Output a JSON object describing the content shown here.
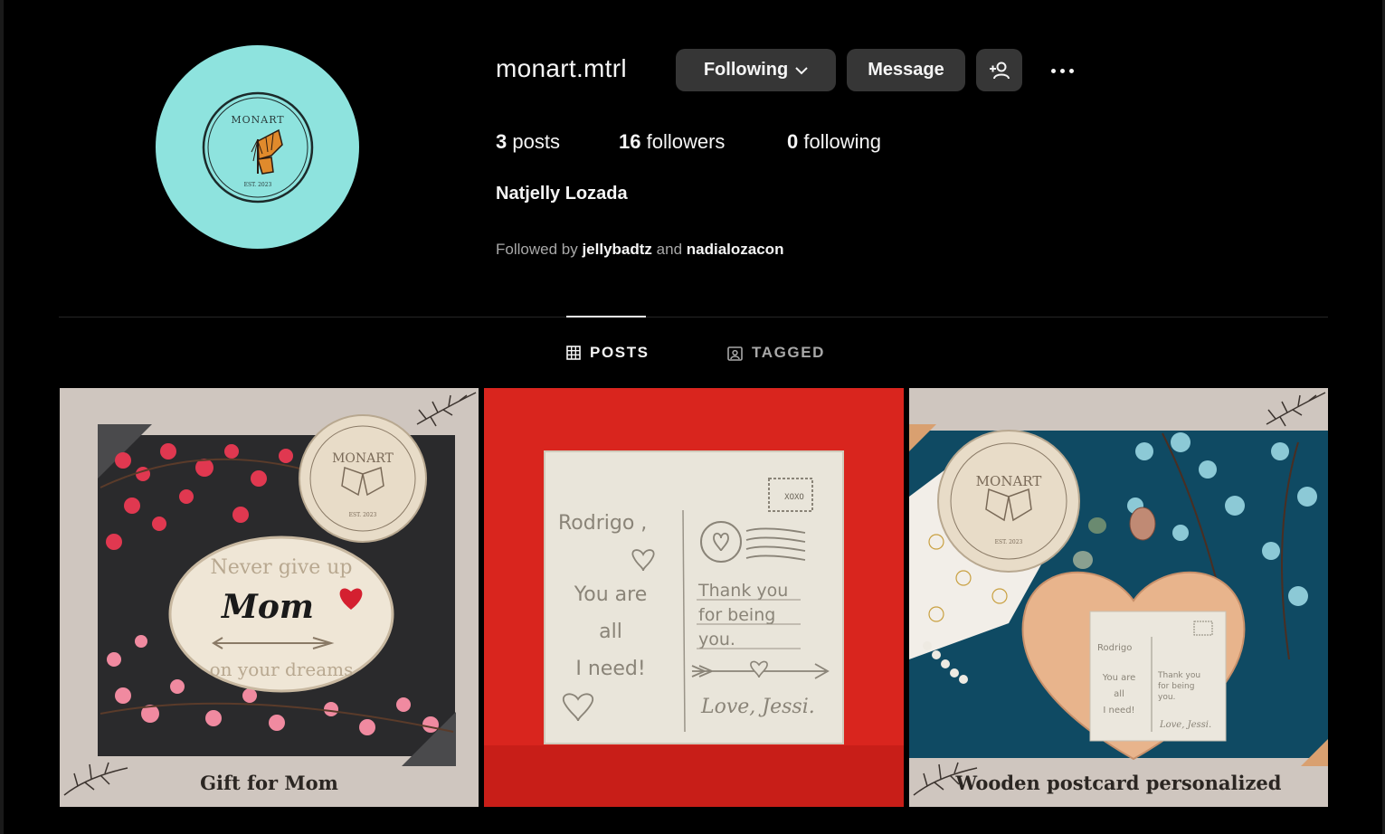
{
  "profile": {
    "username": "monart.mtrl",
    "full_name": "Natjelly Lozada",
    "avatar": {
      "brand_text": "MONART",
      "est_text": "EST. 2023",
      "bg_color": "#8ee3de"
    }
  },
  "actions": {
    "following_label": "Following",
    "message_label": "Message",
    "add_user_icon": "person-add-icon",
    "more_icon": "more-horizontal-icon"
  },
  "stats": {
    "posts_count": "3",
    "posts_label": "posts",
    "followers_count": "16",
    "followers_label": "followers",
    "following_count": "0",
    "following_label": "following"
  },
  "followed_by": {
    "prefix": "Followed by",
    "user1": "jellybadtz",
    "conjunction": "and",
    "user2": "nadialozacon"
  },
  "tabs": [
    {
      "label": "POSTS",
      "icon": "grid-icon",
      "active": true
    },
    {
      "label": "TAGGED",
      "icon": "tagged-icon",
      "active": false
    }
  ],
  "posts": [
    {
      "caption": "Gift for Mom",
      "badge_brand": "MONART",
      "badge_est": "EST. 2023",
      "plaque_top": "Never give up",
      "plaque_mid": "Mom",
      "plaque_bottom": "on your dreams"
    },
    {
      "postcard": {
        "to": "Rodrigo ,",
        "line1": "You are",
        "line2": "all",
        "line3": "I need!",
        "stamp": "XOXO",
        "thank1": "Thank you",
        "thank2": "for being",
        "thank3": "you.",
        "signature": "Love, Jessi."
      }
    },
    {
      "caption": "Wooden postcard personalized",
      "badge_brand": "MONART",
      "badge_est": "EST. 2023",
      "mini_to": "Rodrigo",
      "mini_line1": "You are",
      "mini_line2": "all",
      "mini_line3": "I need!",
      "mini_thank1": "Thank you",
      "mini_thank2": "for being",
      "mini_thank3": "you.",
      "mini_signature": "Love, Jessi."
    }
  ]
}
